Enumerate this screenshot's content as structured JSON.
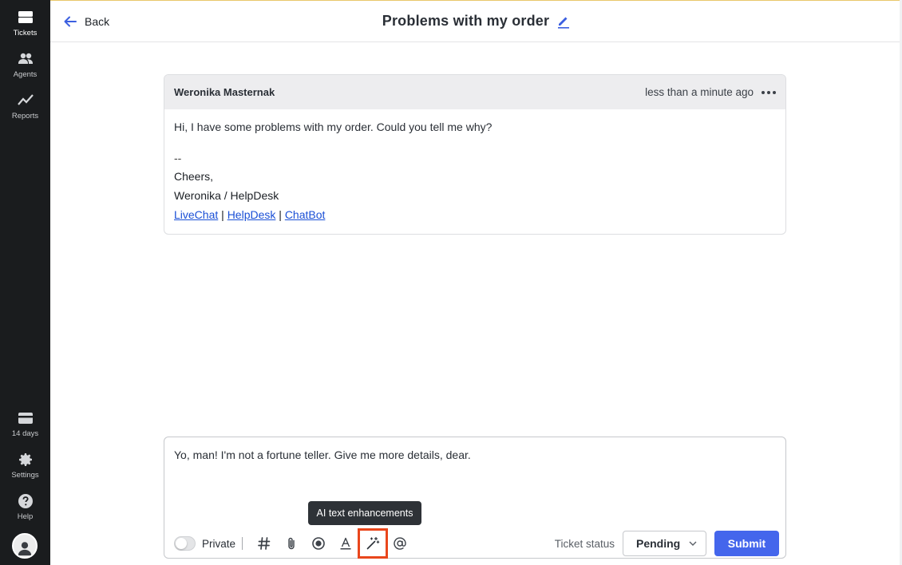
{
  "nav": {
    "items": [
      {
        "label": "Tickets",
        "icon": "tickets-icon"
      },
      {
        "label": "Agents",
        "icon": "agents-icon"
      },
      {
        "label": "Reports",
        "icon": "reports-icon"
      }
    ],
    "bottom": [
      {
        "label": "14 days",
        "icon": "trial-card-icon"
      },
      {
        "label": "Settings",
        "icon": "gear-icon"
      },
      {
        "label": "Help",
        "icon": "help-icon"
      }
    ]
  },
  "header": {
    "back_label": "Back",
    "title": "Problems with my order"
  },
  "message": {
    "author": "Weronika Masternak",
    "time": "less than a minute ago",
    "body": "Hi, I have some problems with my order. Could you tell me why?",
    "signature": {
      "dash": "--",
      "greeting": "Cheers,",
      "sender": "Weronika / HelpDesk",
      "links": [
        "LiveChat",
        "HelpDesk",
        "ChatBot"
      ],
      "link_separator": " | "
    }
  },
  "composer": {
    "draft": "Yo, man! I'm not a fortune teller. Give me more details, dear.",
    "private_label": "Private",
    "tools": [
      "hashtag-icon",
      "paperclip-icon",
      "record-icon",
      "text-format-icon",
      "magic-wand-icon",
      "mention-icon"
    ],
    "tooltip": "AI text enhancements",
    "status_label": "Ticket status",
    "status_value": "Pending",
    "submit_label": "Submit"
  },
  "colors": {
    "accent": "#4466ec",
    "link": "#1a4fd6",
    "highlight": "#e9461c",
    "rail": "#1a1c1e"
  }
}
